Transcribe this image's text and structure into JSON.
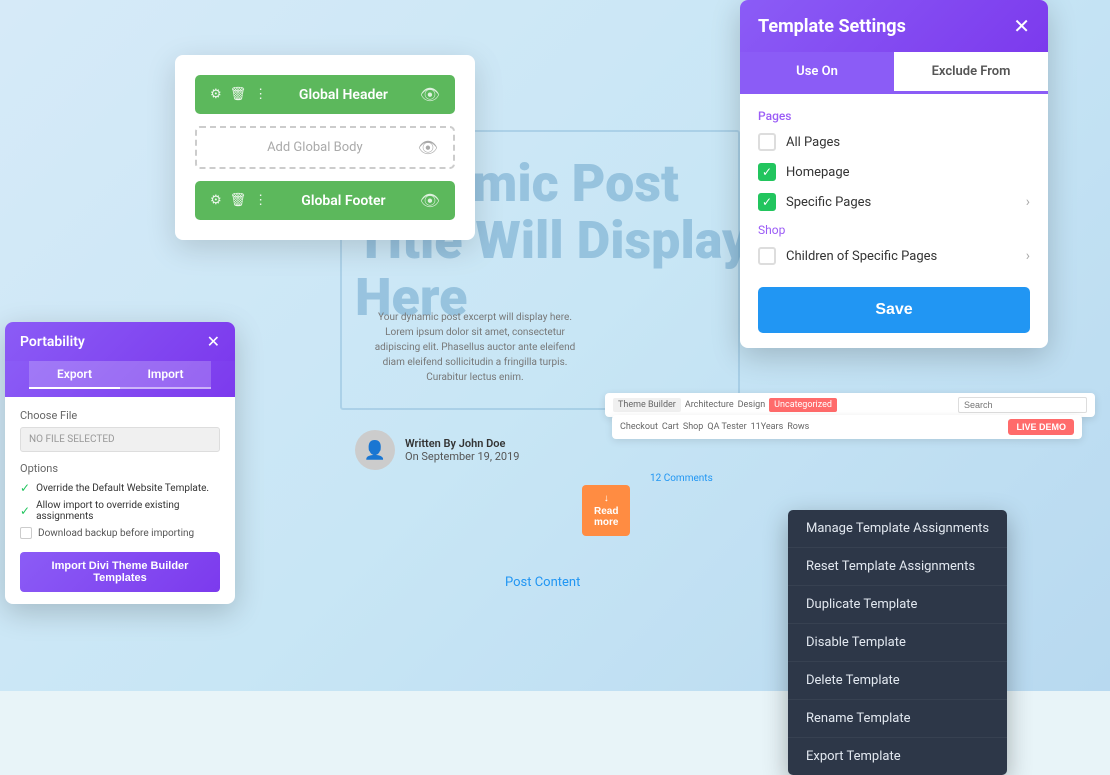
{
  "canvas": {
    "dynamic_text": "Dynamic Post Title Will Display Here",
    "post_excerpt": "Your dynamic post excerpt will display here. Lorem ipsum dolor sit amet, consectetur adipiscing elit. Phasellus auctor ante eleifend diam eleifend sollicitudin a fringilla turpis. Curabitur lectus enim.",
    "author_label": "Written By John Doe",
    "author_date": "On September 19, 2019",
    "post_content_label": "Post Content"
  },
  "template_cards": {
    "header_label": "Global Header",
    "body_placeholder": "Add Global Body",
    "footer_label": "Global Footer"
  },
  "portability": {
    "title": "Portability",
    "close_icon": "✕",
    "export_tab": "Export",
    "import_tab": "Import",
    "choose_file_label": "Choose File",
    "file_placeholder": "NO FILE SELECTED",
    "options_label": "Options",
    "option1": "Override the Default Website Template.",
    "option2": "Allow import to override existing assignments",
    "option3": "Download backup before importing",
    "import_btn": "Import Divi Theme Builder Templates"
  },
  "template_settings": {
    "title": "Template Settings",
    "close_icon": "✕",
    "tab_use_on": "Use On",
    "tab_exclude_from": "Exclude From",
    "pages_label": "Pages",
    "all_pages": "All Pages",
    "homepage": "Homepage",
    "specific_pages": "Specific Pages",
    "shop_label": "Shop",
    "children_of_specific": "Children of Specific Pages",
    "save_btn": "Save"
  },
  "context_menu": {
    "items": [
      "Manage Template Assignments",
      "Reset Template Assignments",
      "Duplicate Template",
      "Disable Template",
      "Delete Template",
      "Rename Template",
      "Export Template"
    ]
  },
  "nav_bar": {
    "items": [
      "Theme Builder",
      "Architecture",
      "Design",
      "Uncategorized"
    ],
    "checkout": "Checkout",
    "cart": "Cart",
    "shop": "Shop",
    "qa_tester": "QA Tester",
    "years": "11Years",
    "rows": "Rows",
    "demo_btn": "LIVE DEMO",
    "search_placeholder": "Search"
  },
  "comments": "12 Comments",
  "read_more": "Read\nmore"
}
